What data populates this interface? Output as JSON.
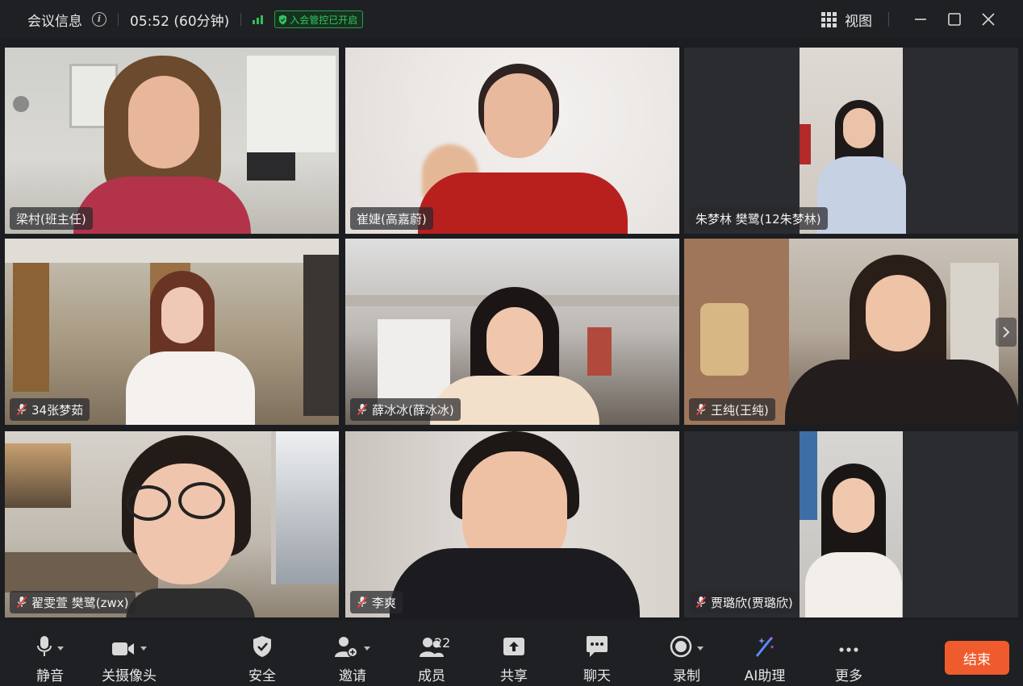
{
  "header": {
    "title": "会议信息",
    "duration": "05:52 (60分钟)",
    "security_badge": "入会管控已开启",
    "view_label": "视图"
  },
  "participants": [
    {
      "name": "梁村(班主任)",
      "muted": false
    },
    {
      "name": "崔婕(高嘉蔚)",
      "muted": false
    },
    {
      "name": "朱梦林 樊鹭(12朱梦林)",
      "muted": false
    },
    {
      "name": "34张梦茹",
      "muted": true
    },
    {
      "name": "薛冰冰(薛冰冰)",
      "muted": true
    },
    {
      "name": "王纯(王纯)",
      "muted": true
    },
    {
      "name": "翟雯萱 樊鹭(zwx)",
      "muted": true
    },
    {
      "name": "李爽",
      "muted": true
    },
    {
      "name": "贾璐欣(贾璐欣)",
      "muted": true
    }
  ],
  "toolbar": {
    "mute": "静音",
    "camera": "关摄像头",
    "security": "安全",
    "invite": "邀请",
    "members": "成员",
    "member_count": "22",
    "share": "共享",
    "chat": "聊天",
    "record": "录制",
    "ai": "AI助理",
    "more": "更多",
    "end": "结束"
  },
  "colors": {
    "end_button": "#ef5b2d",
    "signal": "#2fbf5b",
    "badge": "#37c060"
  }
}
